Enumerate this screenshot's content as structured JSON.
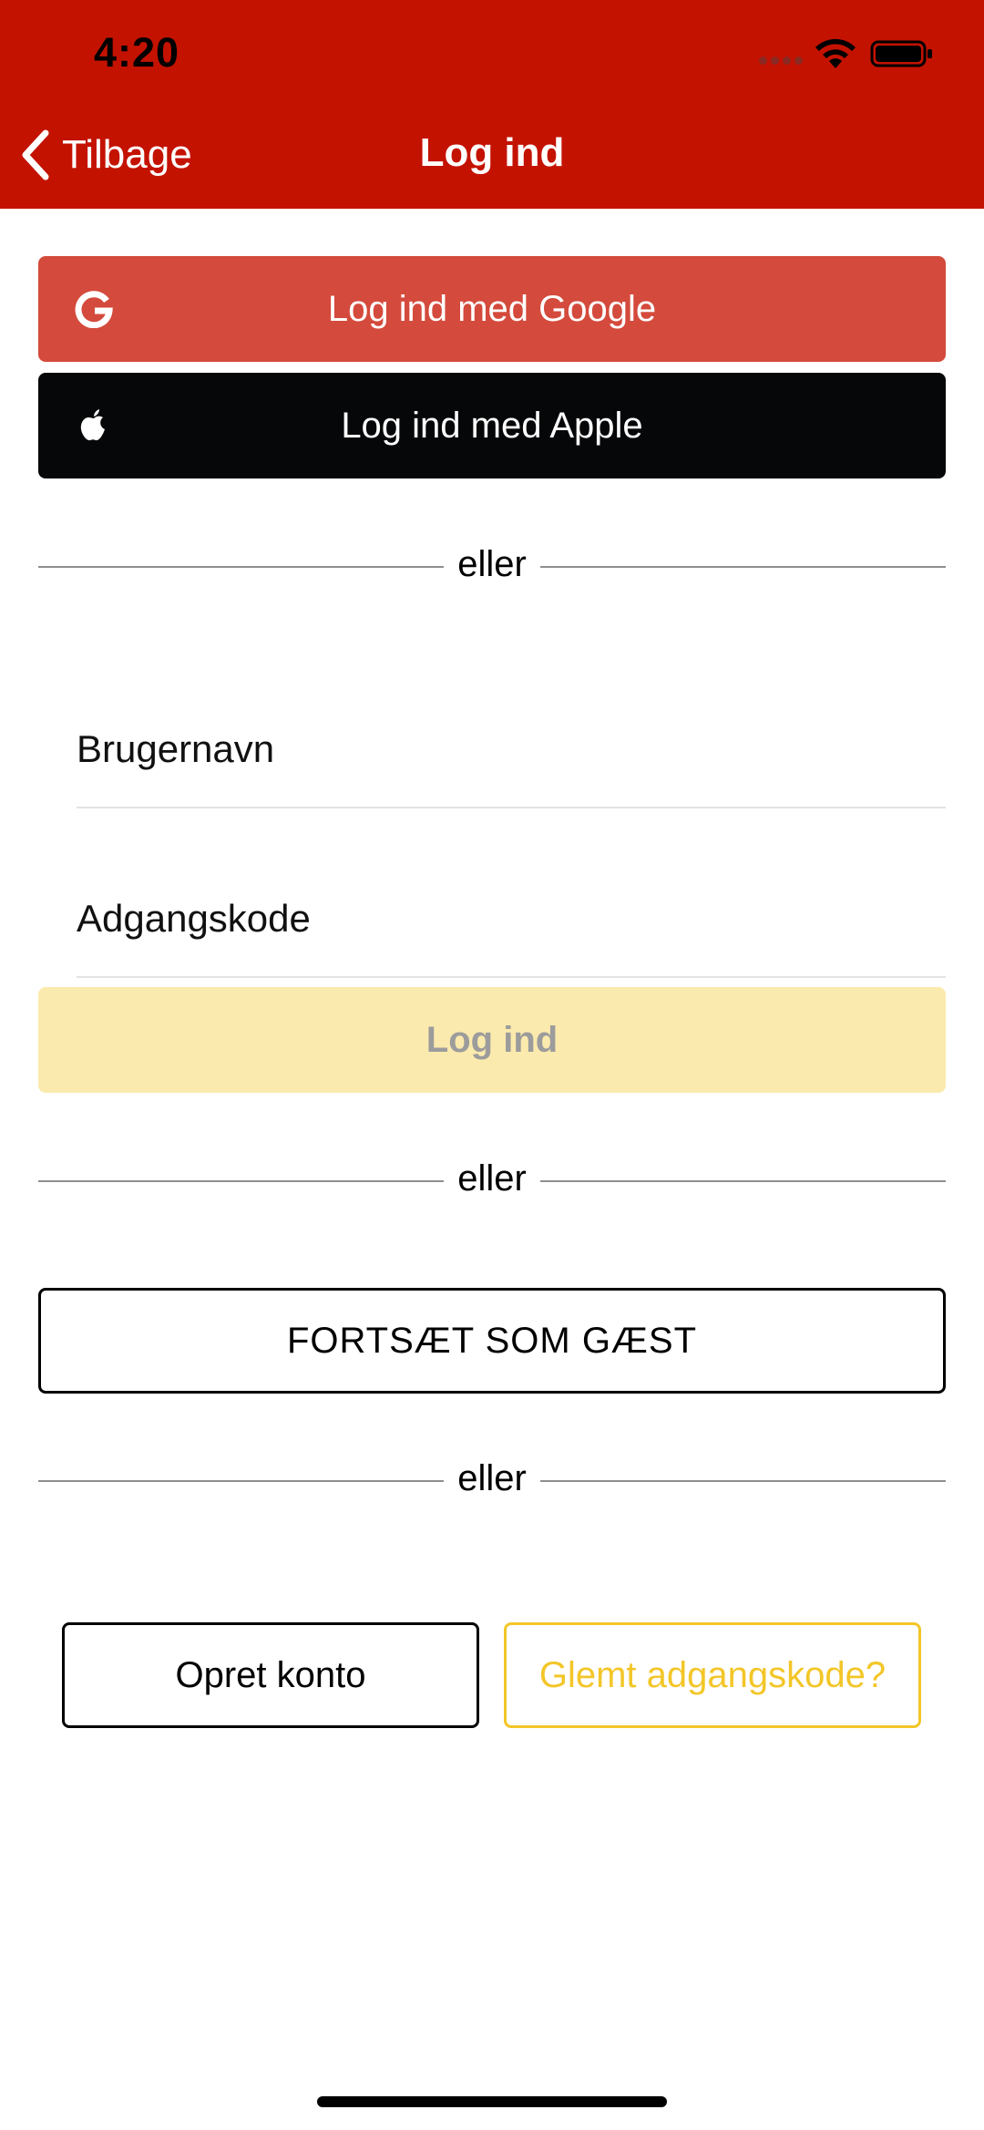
{
  "status_bar": {
    "time": "4:20",
    "icons": [
      "signal-dots-icon",
      "wifi-icon",
      "battery-icon"
    ]
  },
  "nav": {
    "back_label": "Tilbage",
    "title": "Log ind"
  },
  "social": {
    "google_label": "Log ind med Google",
    "apple_label": "Log ind med Apple"
  },
  "dividers": {
    "first": "eller",
    "second": "eller",
    "third": "eller"
  },
  "form": {
    "username_placeholder": "Brugernavn",
    "username_value": "",
    "password_placeholder": "Adgangskode",
    "password_value": "",
    "login_label": "Log ind"
  },
  "guest": {
    "label": "FORTSÆT SOM GÆST"
  },
  "account": {
    "create_label": "Opret konto",
    "forgot_label": "Glemt adgangskode?"
  },
  "colors": {
    "header_bg": "#c41200",
    "google_bg": "#d44a3c",
    "apple_bg": "#060709",
    "login_bg": "#fbeaad",
    "accent_yellow": "#f3c628"
  }
}
